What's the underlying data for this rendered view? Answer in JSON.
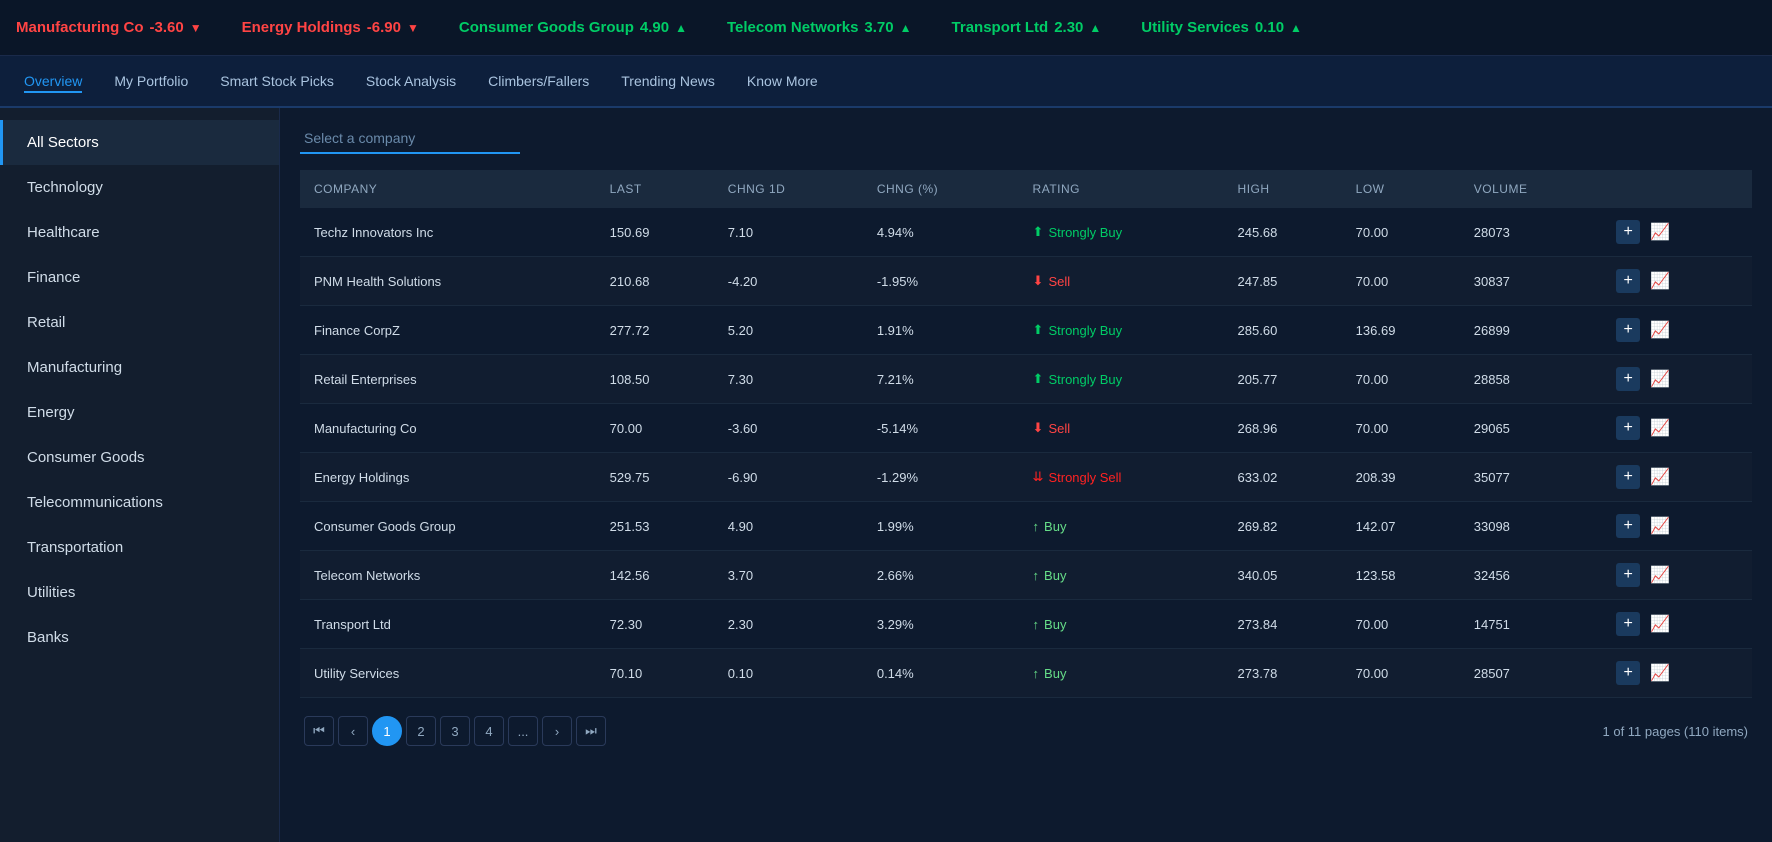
{
  "ticker": {
    "items": [
      {
        "id": "manufacturing-co",
        "name": "Manufacturing Co",
        "change": "-3.60",
        "direction": "down"
      },
      {
        "id": "energy-holdings",
        "name": "Energy Holdings",
        "change": "-6.90",
        "direction": "down"
      },
      {
        "id": "consumer-goods-group",
        "name": "Consumer Goods Group",
        "change": "4.90",
        "direction": "up"
      },
      {
        "id": "telecom-networks",
        "name": "Telecom Networks",
        "change": "3.70",
        "direction": "up"
      },
      {
        "id": "transport-ltd",
        "name": "Transport Ltd",
        "change": "2.30",
        "direction": "up"
      },
      {
        "id": "utility-services",
        "name": "Utility Services",
        "change": "0.10",
        "direction": "up"
      }
    ]
  },
  "nav": {
    "items": [
      {
        "id": "overview",
        "label": "Overview",
        "active": true
      },
      {
        "id": "my-portfolio",
        "label": "My Portfolio",
        "active": false
      },
      {
        "id": "smart-stock-picks",
        "label": "Smart Stock Picks",
        "active": false
      },
      {
        "id": "stock-analysis",
        "label": "Stock Analysis",
        "active": false
      },
      {
        "id": "climbers-fallers",
        "label": "Climbers/Fallers",
        "active": false
      },
      {
        "id": "trending-news",
        "label": "Trending News",
        "active": false
      },
      {
        "id": "know-more",
        "label": "Know More",
        "active": false
      }
    ]
  },
  "sidebar": {
    "items": [
      {
        "id": "all-sectors",
        "label": "All Sectors",
        "active": true
      },
      {
        "id": "technology",
        "label": "Technology",
        "active": false
      },
      {
        "id": "healthcare",
        "label": "Healthcare",
        "active": false
      },
      {
        "id": "finance",
        "label": "Finance",
        "active": false
      },
      {
        "id": "retail",
        "label": "Retail",
        "active": false
      },
      {
        "id": "manufacturing",
        "label": "Manufacturing",
        "active": false
      },
      {
        "id": "energy",
        "label": "Energy",
        "active": false
      },
      {
        "id": "consumer-goods",
        "label": "Consumer Goods",
        "active": false
      },
      {
        "id": "telecommunications",
        "label": "Telecommunications",
        "active": false
      },
      {
        "id": "transportation",
        "label": "Transportation",
        "active": false
      },
      {
        "id": "utilities",
        "label": "Utilities",
        "active": false
      },
      {
        "id": "banks",
        "label": "Banks",
        "active": false
      }
    ]
  },
  "search": {
    "placeholder": "Select a company",
    "value": ""
  },
  "table": {
    "columns": [
      "Company",
      "Last",
      "CHNG 1D",
      "CHNG (%)",
      "Rating",
      "High",
      "Low",
      "Volume",
      ""
    ],
    "rows": [
      {
        "company": "Techz Innovators Inc",
        "last": "150.69",
        "chng1d": "7.10",
        "chngPct": "4.94%",
        "rating": "Strongly Buy",
        "ratingType": "strongly-buy",
        "high": "245.68",
        "low": "70.00",
        "volume": "28073"
      },
      {
        "company": "PNM Health Solutions",
        "last": "210.68",
        "chng1d": "-4.20",
        "chngPct": "-1.95%",
        "rating": "Sell",
        "ratingType": "sell",
        "high": "247.85",
        "low": "70.00",
        "volume": "30837"
      },
      {
        "company": "Finance CorpZ",
        "last": "277.72",
        "chng1d": "5.20",
        "chngPct": "1.91%",
        "rating": "Strongly Buy",
        "ratingType": "strongly-buy",
        "high": "285.60",
        "low": "136.69",
        "volume": "26899"
      },
      {
        "company": "Retail Enterprises",
        "last": "108.50",
        "chng1d": "7.30",
        "chngPct": "7.21%",
        "rating": "Strongly Buy",
        "ratingType": "strongly-buy",
        "high": "205.77",
        "low": "70.00",
        "volume": "28858"
      },
      {
        "company": "Manufacturing Co",
        "last": "70.00",
        "chng1d": "-3.60",
        "chngPct": "-5.14%",
        "rating": "Sell",
        "ratingType": "sell",
        "high": "268.96",
        "low": "70.00",
        "volume": "29065"
      },
      {
        "company": "Energy Holdings",
        "last": "529.75",
        "chng1d": "-6.90",
        "chngPct": "-1.29%",
        "rating": "Strongly Sell",
        "ratingType": "strongly-sell",
        "high": "633.02",
        "low": "208.39",
        "volume": "35077"
      },
      {
        "company": "Consumer Goods Group",
        "last": "251.53",
        "chng1d": "4.90",
        "chngPct": "1.99%",
        "rating": "Buy",
        "ratingType": "buy",
        "high": "269.82",
        "low": "142.07",
        "volume": "33098"
      },
      {
        "company": "Telecom Networks",
        "last": "142.56",
        "chng1d": "3.70",
        "chngPct": "2.66%",
        "rating": "Buy",
        "ratingType": "buy",
        "high": "340.05",
        "low": "123.58",
        "volume": "32456"
      },
      {
        "company": "Transport Ltd",
        "last": "72.30",
        "chng1d": "2.30",
        "chngPct": "3.29%",
        "rating": "Buy",
        "ratingType": "buy",
        "high": "273.84",
        "low": "70.00",
        "volume": "14751"
      },
      {
        "company": "Utility Services",
        "last": "70.10",
        "chng1d": "0.10",
        "chngPct": "0.14%",
        "rating": "Buy",
        "ratingType": "buy",
        "high": "273.78",
        "low": "70.00",
        "volume": "28507"
      }
    ]
  },
  "pagination": {
    "current": 1,
    "pages": [
      1,
      2,
      3,
      4
    ],
    "total_pages": 11,
    "total_items": 110,
    "info": "1 of 11 pages (110 items)"
  }
}
